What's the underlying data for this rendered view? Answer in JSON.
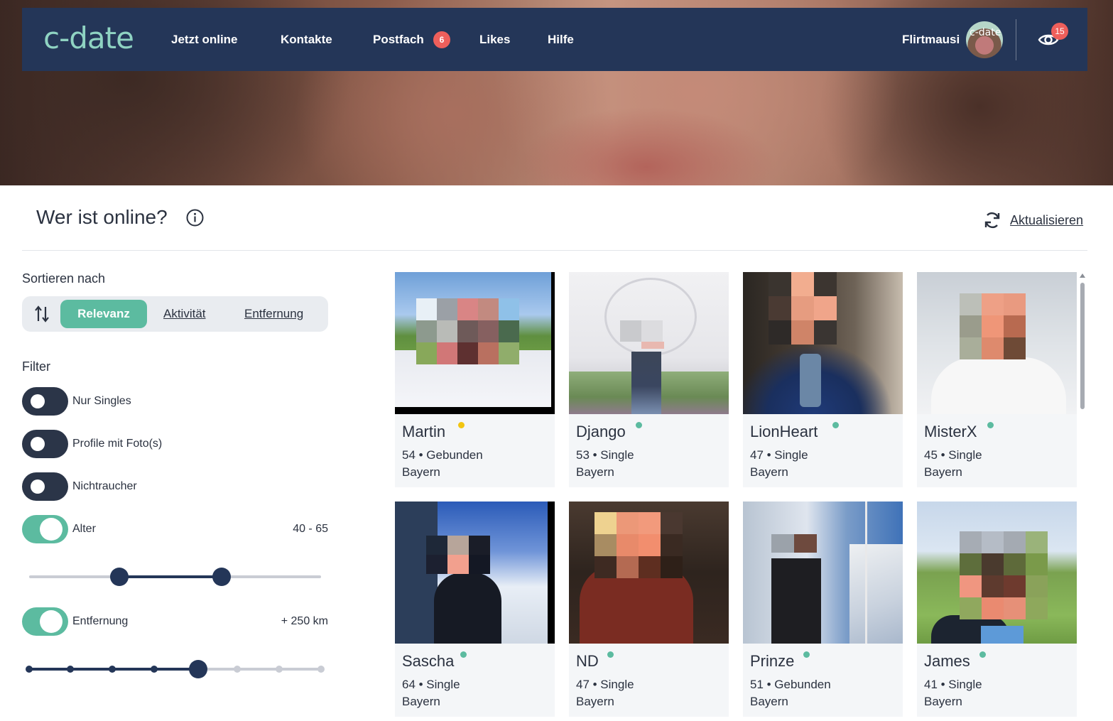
{
  "nav": {
    "logo": "c-date",
    "items": [
      "Jetzt online",
      "Kontakte",
      "Postfach",
      "Likes",
      "Hilfe"
    ],
    "postfach_badge": "6",
    "user_name": "Flirtmausi",
    "avatar_text": "c-date",
    "views_badge": "15"
  },
  "header": {
    "title": "Wer ist online?",
    "refresh_label": "Aktualisieren"
  },
  "sidebar": {
    "sort_label": "Sortieren nach",
    "sort_options": [
      "Relevanz",
      "Aktivität",
      "Entfernung"
    ],
    "sort_selected": "Relevanz",
    "filter_label": "Filter",
    "filters": [
      {
        "label": "Nur Singles",
        "on": false
      },
      {
        "label": "Profile mit Foto(s)",
        "on": false
      },
      {
        "label": "Nichtraucher",
        "on": false
      },
      {
        "label": "Alter",
        "on": true,
        "value": "40 - 65"
      },
      {
        "label": "Entfernung",
        "on": true,
        "value": "+ 250 km"
      }
    ],
    "age_range": {
      "min": 40,
      "max": 65
    },
    "distance_step": {
      "current": 4,
      "steps": 8
    }
  },
  "colors": {
    "nav_bg": "#243658",
    "accent": "#5cbba0",
    "badge": "#ee5f5b",
    "online_green": "#5cbba0",
    "online_yellow": "#f2c511"
  },
  "profiles": [
    {
      "name": "Martin",
      "age_status": "54 • Gebunden",
      "region": "Bayern",
      "status": "yellow"
    },
    {
      "name": "Django",
      "age_status": "53 • Single",
      "region": "Bayern",
      "status": "green"
    },
    {
      "name": "LionHeart",
      "age_status": "47 • Single",
      "region": "Bayern",
      "status": "green"
    },
    {
      "name": "MisterX",
      "age_status": "45 • Single",
      "region": "Bayern",
      "status": "green"
    },
    {
      "name": "Sascha",
      "age_status": "64 • Single",
      "region": "Bayern",
      "status": "green"
    },
    {
      "name": "ND",
      "age_status": "47 • Single",
      "region": "Bayern",
      "status": "green"
    },
    {
      "name": "Prinze",
      "age_status": "51 • Gebunden",
      "region": "Bayern",
      "status": "green"
    },
    {
      "name": "James",
      "age_status": "41 • Single",
      "region": "Bayern",
      "status": "green"
    }
  ]
}
